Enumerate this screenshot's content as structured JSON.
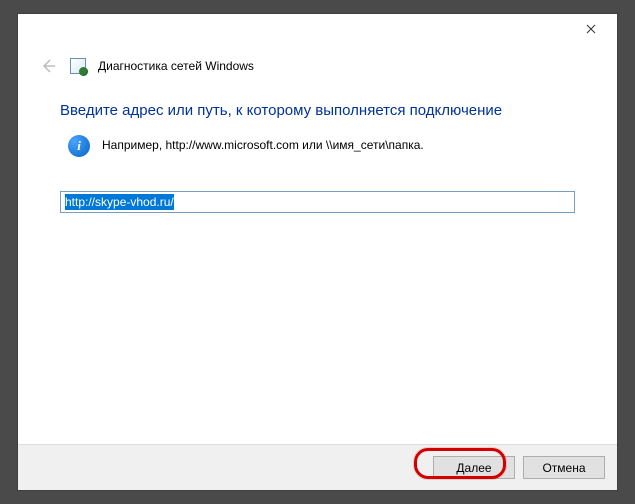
{
  "header": {
    "title": "Диагностика сетей Windows"
  },
  "content": {
    "heading": "Введите адрес или путь, к которому выполняется подключение",
    "hint": "Например, http://www.microsoft.com или \\\\имя_сети\\папка.",
    "info_icon_glyph": "i",
    "input_value": "http://skype-vhod.ru/"
  },
  "footer": {
    "next_label": "Далее",
    "cancel_label": "Отмена"
  }
}
